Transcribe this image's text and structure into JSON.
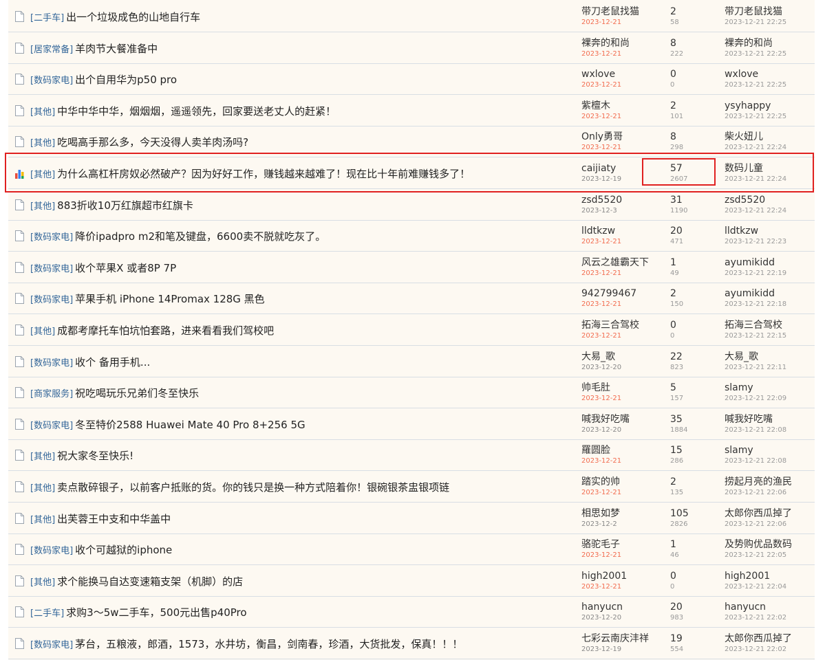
{
  "threads": [
    {
      "category": "[二手车]",
      "title": "出一个垃圾成色的山地自行车",
      "author": "带刀老鼠找猫",
      "post_date": "2023-12-21",
      "replies": "2",
      "views": "58",
      "last_poster": "带刀老鼠找猫",
      "last_time": "2023-12-21 22:25",
      "post_date_recent": true,
      "icon": "document-icon"
    },
    {
      "category": "[居家常备]",
      "title": "羊肉节大餐准备中",
      "author": "裸奔的和尚",
      "post_date": "2023-12-21",
      "replies": "8",
      "views": "222",
      "last_poster": "裸奔的和尚",
      "last_time": "2023-12-21 22:25",
      "post_date_recent": true,
      "icon": "document-icon"
    },
    {
      "category": "[数码家电]",
      "title": "出个自用华为p50 pro",
      "author": "wxlove",
      "post_date": "2023-12-21",
      "replies": "0",
      "views": "0",
      "last_poster": "wxlove",
      "last_time": "2023-12-21 22:25",
      "post_date_recent": true,
      "icon": "document-icon"
    },
    {
      "category": "[其他]",
      "title": "中华中华中华，烟烟烟，遥遥领先，回家要送老丈人的赶紧！",
      "author": "紫檀木",
      "post_date": "2023-12-21",
      "replies": "2",
      "views": "101",
      "last_poster": "ysyhappy",
      "last_time": "2023-12-21 22:25",
      "post_date_recent": true,
      "icon": "document-icon"
    },
    {
      "category": "[其他]",
      "title": "吃喝高手那么多，今天没得人卖羊肉汤吗?",
      "author": "Only勇哥",
      "post_date": "2023-12-21",
      "replies": "8",
      "views": "298",
      "last_poster": "柴火妞儿",
      "last_time": "2023-12-21 22:24",
      "post_date_recent": true,
      "icon": "document-icon"
    },
    {
      "category": "[其他]",
      "title": "为什么高杠杆房奴必然破产？因为好好工作，赚钱越来越难了！现在比十年前难赚钱多了！",
      "author": "caijiaty",
      "post_date": "2023-12-19",
      "replies": "57",
      "views": "2607",
      "last_poster": "数码儿童",
      "last_time": "2023-12-21 22:24",
      "post_date_recent": false,
      "icon": "poll-icon"
    },
    {
      "category": "[其他]",
      "title": "883折收10万红旗超市红旗卡",
      "author": "zsd5520",
      "post_date": "2023-12-3",
      "replies": "31",
      "views": "1190",
      "last_poster": "zsd5520",
      "last_time": "2023-12-21 22:24",
      "post_date_recent": false,
      "icon": "document-icon"
    },
    {
      "category": "[数码家电]",
      "title": "降价ipadpro m2和笔及键盘，6600卖不脱就吃灰了。",
      "author": "lldtkzw",
      "post_date": "2023-12-21",
      "replies": "20",
      "views": "471",
      "last_poster": "lldtkzw",
      "last_time": "2023-12-21 22:23",
      "post_date_recent": true,
      "icon": "document-icon"
    },
    {
      "category": "[数码家电]",
      "title": "收个苹果X 或者8P 7P",
      "author": "风云之雄霸天下",
      "post_date": "2023-12-21",
      "replies": "1",
      "views": "49",
      "last_poster": "ayumikidd",
      "last_time": "2023-12-21 22:19",
      "post_date_recent": true,
      "icon": "document-icon"
    },
    {
      "category": "[数码家电]",
      "title": "苹果手机 iPhone 14Promax 128G 黑色",
      "author": "942799467",
      "post_date": "2023-12-21",
      "replies": "2",
      "views": "150",
      "last_poster": "ayumikidd",
      "last_time": "2023-12-21 22:18",
      "post_date_recent": true,
      "icon": "document-icon"
    },
    {
      "category": "[其他]",
      "title": "成都考摩托车怕坑怕套路，进来看看我们驾校吧",
      "author": "拓海三合驾校",
      "post_date": "2023-12-21",
      "replies": "0",
      "views": "0",
      "last_poster": "拓海三合驾校",
      "last_time": "2023-12-21 22:15",
      "post_date_recent": true,
      "icon": "document-icon"
    },
    {
      "category": "[数码家电]",
      "title": "收个 备用手机...",
      "author": "大易_歌",
      "post_date": "2023-12-20",
      "replies": "22",
      "views": "823",
      "last_poster": "大易_歌",
      "last_time": "2023-12-21 22:11",
      "post_date_recent": false,
      "icon": "document-icon"
    },
    {
      "category": "[商家服务]",
      "title": "祝吃喝玩乐兄弟们冬至快乐",
      "author": "帅毛肚",
      "post_date": "2023-12-21",
      "replies": "5",
      "views": "157",
      "last_poster": "slamy",
      "last_time": "2023-12-21 22:09",
      "post_date_recent": true,
      "icon": "document-icon"
    },
    {
      "category": "[数码家电]",
      "title": "冬至特价2588 Huawei Mate 40 Pro 8+256 5G",
      "author": "喊我好吃嘴",
      "post_date": "2023-12-20",
      "replies": "35",
      "views": "1884",
      "last_poster": "喊我好吃嘴",
      "last_time": "2023-12-21 22:08",
      "post_date_recent": false,
      "icon": "document-icon"
    },
    {
      "category": "[其他]",
      "title": "祝大家冬至快乐!",
      "author": "羅圆脸",
      "post_date": "2023-12-21",
      "replies": "15",
      "views": "286",
      "last_poster": "slamy",
      "last_time": "2023-12-21 22:08",
      "post_date_recent": true,
      "icon": "document-icon"
    },
    {
      "category": "[其他]",
      "title": "卖点散碎银子，以前客户抵账的货。你的钱只是换一种方式陪着你！银碗银茶盅银项链",
      "author": "踏实的帅",
      "post_date": "2023-12-21",
      "replies": "2",
      "views": "135",
      "last_poster": "捞起月亮的渔民",
      "last_time": "2023-12-21 22:06",
      "post_date_recent": true,
      "icon": "document-icon"
    },
    {
      "category": "[其他]",
      "title": "出芙蓉王中支和中华盖中",
      "author": "相思如梦",
      "post_date": "2023-12-2",
      "replies": "105",
      "views": "2826",
      "last_poster": "太郎你西瓜掉了",
      "last_time": "2023-12-21 22:06",
      "post_date_recent": false,
      "icon": "document-icon"
    },
    {
      "category": "[数码家电]",
      "title": "收个可越狱的iphone",
      "author": "骆驼毛子",
      "post_date": "2023-12-21",
      "replies": "1",
      "views": "46",
      "last_poster": "及势购优品数码",
      "last_time": "2023-12-21 22:05",
      "post_date_recent": true,
      "icon": "document-icon"
    },
    {
      "category": "[其他]",
      "title": "求个能换马自达变速箱支架（机脚）的店",
      "author": "high2001",
      "post_date": "2023-12-21",
      "replies": "0",
      "views": "0",
      "last_poster": "high2001",
      "last_time": "2023-12-21 22:04",
      "post_date_recent": true,
      "icon": "document-icon"
    },
    {
      "category": "[二手车]",
      "title": "求购3～5w二手车，500元出售p40Pro",
      "author": "hanyucn",
      "post_date": "2023-12-20",
      "replies": "20",
      "views": "983",
      "last_poster": "hanyucn",
      "last_time": "2023-12-21 22:02",
      "post_date_recent": false,
      "icon": "document-icon"
    },
    {
      "category": "[数码家电]",
      "title": "茅台，五粮液，郎酒，1573，水井坊，衡昌，剑南春，珍酒，大货批发，保真！！！",
      "author": "七彩云南庆沣祥",
      "post_date": "2023-12-19",
      "replies": "19",
      "views": "554",
      "last_poster": "太郎你西瓜掉了",
      "last_time": "2023-12-21 22:02",
      "post_date_recent": false,
      "icon": "document-icon"
    }
  ],
  "highlight": {
    "thread_index": 5,
    "color": "#e02020"
  },
  "colors": {
    "category": "#336699",
    "recent_date": "#f26c4f",
    "old_date": "#888888",
    "row_bg": "#fdf9f2",
    "divider": "#d8dee4"
  }
}
